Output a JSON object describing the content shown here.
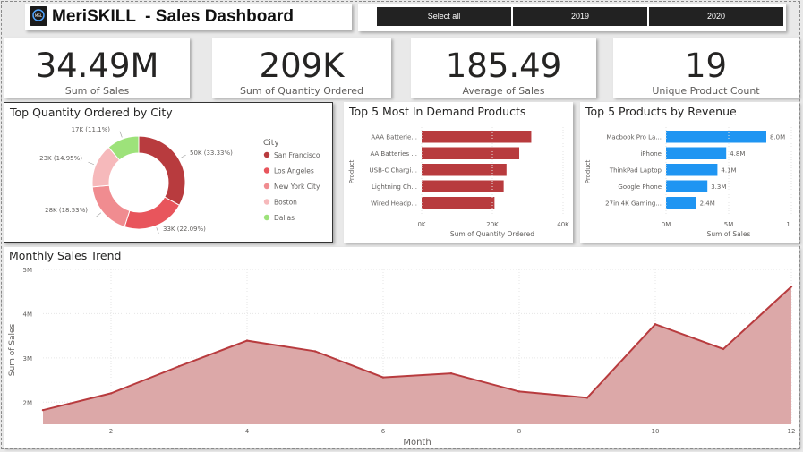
{
  "header": {
    "title": "MeriSKILL  - Sales Dashboard",
    "logo_text": "MSL",
    "slicers": [
      "Select all",
      "2019",
      "2020"
    ]
  },
  "kpis": [
    {
      "value": "34.49M",
      "label": "Sum of Sales"
    },
    {
      "value": "209K",
      "label": "Sum of Quantity Ordered"
    },
    {
      "value": "185.49",
      "label": "Average of Sales"
    },
    {
      "value": "19",
      "label": "Unique Product Count"
    }
  ],
  "colors": {
    "sf": "#b83b3e",
    "la": "#e8555c",
    "ny": "#f08c90",
    "boston": "#f6b9bb",
    "dallas": "#9de27a",
    "bar_red": "#b83b3e",
    "bar_blue": "#1f95f2",
    "area_fill": "#dca8a8",
    "area_line": "#b83b3e"
  },
  "city_chart": {
    "title": "Top Quantity Ordered by City",
    "legend_title": "City",
    "chart_data": {
      "type": "pie",
      "categories": [
        "San Francisco",
        "Los Angeles",
        "New York City",
        "Boston",
        "Dallas"
      ],
      "values": [
        50,
        33,
        28,
        23,
        17
      ],
      "labels": [
        "50K (33.33%)",
        "33K (22.09%)",
        "28K (18.53%)",
        "23K (14.95%)",
        "17K (11.1%)"
      ]
    }
  },
  "demand_chart": {
    "title": "Top 5 Most In Demand Products",
    "xlabel": "Sum of Quantity Ordered",
    "ylabel": "Product",
    "xticks": [
      "0K",
      "20K",
      "40K"
    ],
    "chart_data": {
      "type": "bar",
      "categories": [
        "AAA Batterie...",
        "AA Batteries ...",
        "USB-C Chargi...",
        "Lightning Ch...",
        "Wired Headp..."
      ],
      "values": [
        31000,
        27600,
        24000,
        23200,
        20600
      ],
      "xlim": [
        0,
        40000
      ]
    }
  },
  "revenue_chart": {
    "title": "Top 5 Products by Revenue",
    "xlabel": "Sum of Sales",
    "ylabel": "Product",
    "xticks": [
      "0M",
      "5M",
      "1..."
    ],
    "chart_data": {
      "type": "bar",
      "categories": [
        "Macbook Pro La...",
        "iPhone",
        "ThinkPad Laptop",
        "Google Phone",
        "27in 4K Gaming..."
      ],
      "values": [
        8.0,
        4.8,
        4.1,
        3.3,
        2.4
      ],
      "data_labels": [
        "8.0M",
        "4.8M",
        "4.1M",
        "3.3M",
        "2.4M"
      ],
      "xlim": [
        0,
        10
      ]
    }
  },
  "trend_chart": {
    "title": "Monthly Sales Trend",
    "xlabel": "Month",
    "ylabel": "Sum of Sales",
    "yticks": [
      "2M",
      "3M",
      "4M",
      "5M"
    ],
    "xticks": [
      "2",
      "4",
      "6",
      "8",
      "10",
      "12"
    ],
    "chart_data": {
      "type": "area",
      "x": [
        1,
        2,
        3,
        4,
        5,
        6,
        7,
        8,
        9,
        10,
        11,
        12
      ],
      "values": [
        1.82,
        2.2,
        2.81,
        3.39,
        3.15,
        2.56,
        2.65,
        2.24,
        2.1,
        3.76,
        3.2,
        4.61
      ],
      "ylim": [
        1.5,
        5.0
      ],
      "xlim": [
        1,
        12
      ]
    }
  }
}
